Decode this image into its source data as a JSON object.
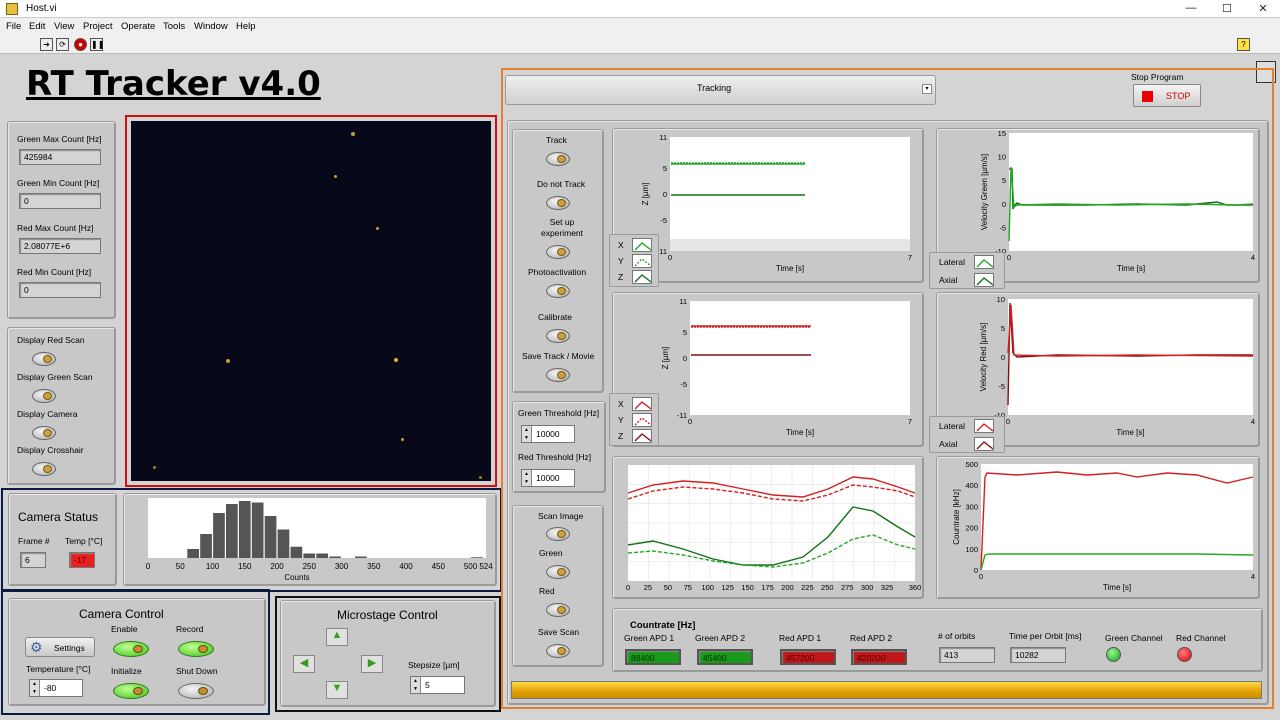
{
  "window": {
    "title": "Host.vi"
  },
  "menu": [
    "File",
    "Edit",
    "View",
    "Project",
    "Operate",
    "Tools",
    "Window",
    "Help"
  ],
  "app_title": "RT Tracker v4.0",
  "counts": {
    "green_max_label": "Green Max Count [Hz]",
    "green_max": "425984",
    "green_min_label": "Green Min Count [Hz]",
    "green_min": "0",
    "red_max_label": "Red Max Count [Hz]",
    "red_max": "2.08077E+6",
    "red_min_label": "Red Min Count [Hz]",
    "red_min": "0"
  },
  "display": {
    "red_scan": "Display Red Scan",
    "green_scan": "Display Green Scan",
    "camera": "Display Camera",
    "crosshair": "Display Crosshair"
  },
  "camera_status": {
    "title": "Camera Status",
    "frame_label": "Frame #",
    "frame": "6",
    "temp_label": "Temp [°C]",
    "temp": "-17"
  },
  "histogram": {
    "xlabel": "Counts",
    "ticks": [
      "0",
      "50",
      "100",
      "150",
      "200",
      "250",
      "300",
      "350",
      "400",
      "450",
      "500",
      "524"
    ],
    "values": [
      0,
      0,
      0,
      12,
      32,
      60,
      72,
      76,
      74,
      56,
      38,
      15,
      6,
      6,
      2,
      0,
      2,
      0,
      0,
      0,
      0,
      0,
      0,
      0,
      0,
      1
    ]
  },
  "camera_control": {
    "title": "Camera Control",
    "settings": "Settings",
    "enable": "Enable",
    "record": "Record",
    "temp_label": "Temperature [°C]",
    "temp": "-80",
    "initialize": "Initialize",
    "shutdown": "Shut Down"
  },
  "microstage": {
    "title": "Microstage Control",
    "step_label": "Stepsize [µm]",
    "step": "5"
  },
  "tracking": {
    "tab": "Tracking",
    "stop_label": "Stop Program",
    "stop": "STOP"
  },
  "modes": {
    "track": "Track",
    "do_not_track": "Do not Track",
    "setup": "Set up experiment",
    "photoactivation": "Photoactivation",
    "calibrate": "Calibrate",
    "save": "Save Track / Movie"
  },
  "thresholds": {
    "green_label": "Green Threshold [Hz]",
    "green": "10000",
    "red_label": "Red Threshold [Hz]",
    "red": "10000"
  },
  "scan": {
    "title": "Scan Image",
    "green": "Green",
    "red": "Red",
    "save": "Save Scan"
  },
  "legend_xyz": [
    "X",
    "Y",
    "Z"
  ],
  "legend_la": [
    "Lateral",
    "Axial"
  ],
  "plot_z": {
    "ylabel": "Z [µm]",
    "xlabel": "Time [s]"
  },
  "plot_vg": {
    "ylabel": "Velocity Green [µm/s]",
    "xlabel": "Time [s]"
  },
  "plot_vr": {
    "ylabel": "Velocity Red [µm/s]",
    "xlabel": "Time [s]"
  },
  "plot_cr": {
    "ylabel": "Countrate [kHz]",
    "xlabel": "Time [s]"
  },
  "countrate": {
    "title": "Countrate [Hz]",
    "g1_label": "Green APD 1",
    "g1": "88400",
    "g2_label": "Green APD 2",
    "g2": "45400",
    "r1_label": "Red APD 1",
    "r1": "457200",
    "r2_label": "Red APD 2",
    "r2": "420200",
    "orbits_label": "# of orbits",
    "orbits": "413",
    "tpo_label": "Time per Orbit [ms]",
    "tpo": "10282",
    "gch_label": "Green Channel",
    "rch_label": "Red Channel"
  },
  "chart_data": [
    {
      "type": "line",
      "ylabel": "Z [µm]",
      "xlabel": "Time [s]",
      "xlim": [
        0,
        7
      ],
      "yticks": [
        11,
        5,
        0,
        -5,
        -11
      ],
      "xticks": [
        0,
        7
      ],
      "series": [
        {
          "values": [
            6,
            6
          ]
        },
        {
          "values": [
            -1,
            -1
          ]
        }
      ]
    },
    {
      "type": "line",
      "ylabel": "Velocity Green [µm/s]",
      "xlabel": "Time [s]",
      "xlim": [
        0,
        4
      ],
      "ylim": [
        -10,
        15
      ],
      "yticks": [
        15,
        10,
        5,
        0,
        -5,
        -10
      ],
      "xticks": [
        0,
        4
      ]
    },
    {
      "type": "line",
      "ylabel": "Z [µm]",
      "xlabel": "Time [s]",
      "xlim": [
        0,
        7
      ],
      "yticks": [
        11,
        5,
        0,
        -5,
        -11
      ],
      "xticks": [
        0,
        7
      ],
      "series": [
        {
          "values": [
            6,
            6
          ]
        },
        {
          "values": [
            0,
            0
          ]
        }
      ]
    },
    {
      "type": "line",
      "ylabel": "Velocity Red [µm/s]",
      "xlabel": "Time [s]",
      "xlim": [
        0,
        4
      ],
      "ylim": [
        -10,
        10
      ],
      "yticks": [
        10,
        5,
        0,
        -5,
        -10
      ],
      "xticks": [
        0,
        4
      ]
    },
    {
      "type": "line",
      "xlim": [
        0,
        360
      ],
      "xticks": [
        0,
        25,
        50,
        75,
        100,
        125,
        150,
        175,
        200,
        225,
        250,
        275,
        300,
        325,
        360
      ]
    },
    {
      "type": "line",
      "ylabel": "Countrate [kHz]",
      "xlabel": "Time [s]",
      "xlim": [
        0,
        4
      ],
      "ylim": [
        0,
        500
      ],
      "yticks": [
        500,
        400,
        300,
        200,
        100,
        0
      ],
      "xticks": [
        0,
        4
      ]
    }
  ],
  "colors": {
    "green": "#22a822",
    "darkgreen": "#147014",
    "red": "#d42020",
    "darkred": "#801010",
    "orange": "#e08030",
    "navy": "#0a1a40"
  }
}
